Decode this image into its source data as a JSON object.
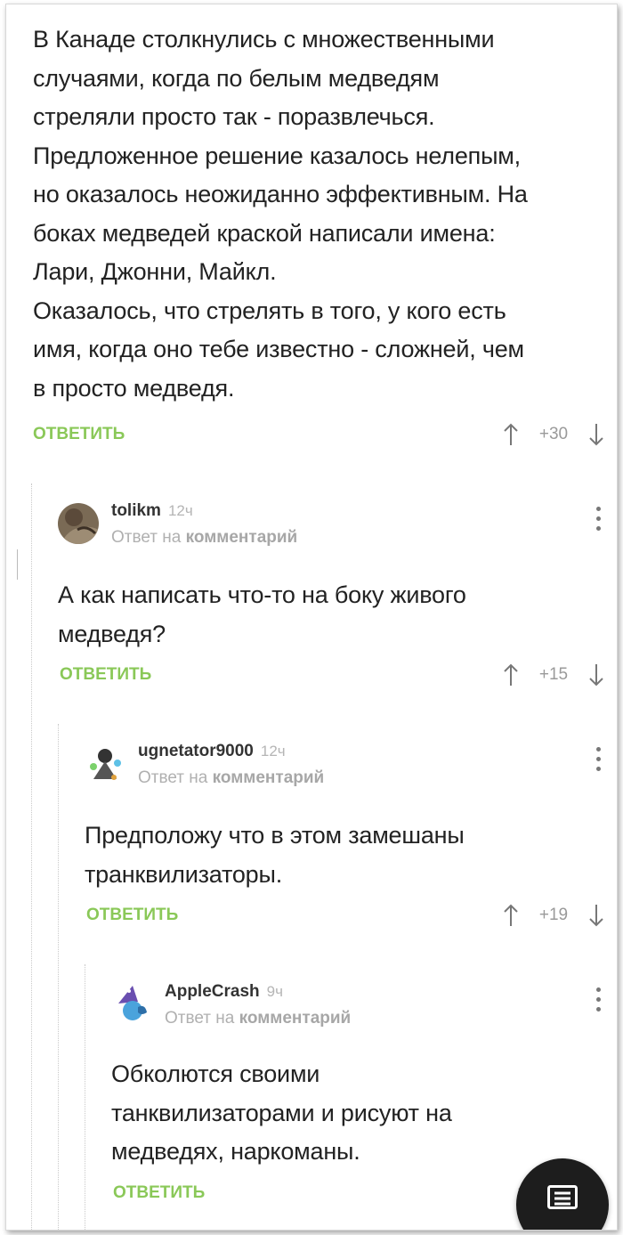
{
  "root_comment": {
    "text": "В Канаде столкнулись с множественными\nслучаями, когда по белым медведям\nстреляли просто так - поразвлечься.\nПредложенное решение казалось нелепым,\nно оказалось неожиданно эффективным. На\nбоках медведей краской написали имена:\nЛари, Джонни, Майкл.\nОказалось, что стрелять в того, у кого есть\nимя, когда оно тебе известно - сложней, чем\nв просто медведя.",
    "reply_label": "ОТВЕТИТЬ",
    "score": "+30"
  },
  "replies": [
    {
      "author": "tolikm",
      "time": "12ч",
      "reply_to_prefix": "Ответ на",
      "reply_to_link": "комментарий",
      "text": "А как написать что-то на боку живого\nмедведя?",
      "reply_label": "ОТВЕТИТЬ",
      "score": "+15"
    },
    {
      "author": "ugnetator9000",
      "time": "12ч",
      "reply_to_prefix": "Ответ на",
      "reply_to_link": "комментарий",
      "text": "Предположу что в этом замешаны\nтранквилизаторы.",
      "reply_label": "ОТВЕТИТЬ",
      "score": "+19"
    },
    {
      "author": "AppleCrash",
      "time": "9ч",
      "reply_to_prefix": "Ответ на",
      "reply_to_link": "комментарий",
      "text": "Обколются своими\nтанквилизаторами и рисуют на\nмедведях, наркоманы.",
      "reply_label": "ОТВЕТИТЬ"
    }
  ],
  "icons": {
    "upvote": "arrow-up-icon",
    "downvote": "arrow-down-icon",
    "menu": "more-vertical-icon",
    "fab": "comments-icon"
  },
  "colors": {
    "accent_green": "#8ac858",
    "muted": "#b0b0b0",
    "fab": "#1d1d1d"
  }
}
